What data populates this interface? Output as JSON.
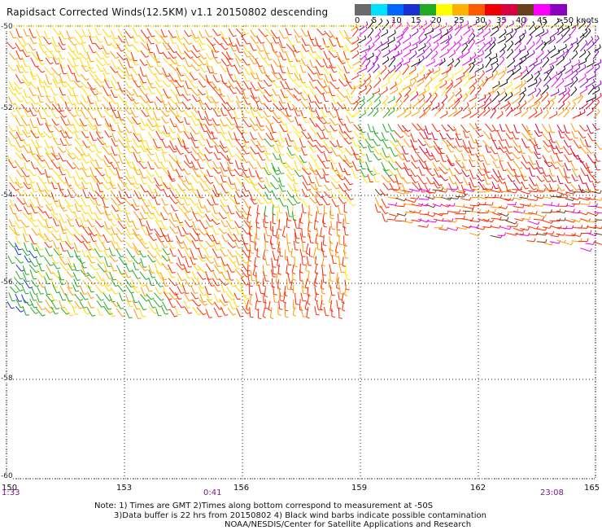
{
  "title": "Rapidsact Corrected Winds(12.5KM) v1.1 20150802 descending",
  "colorbar": {
    "labels": [
      "0",
      "5",
      "10",
      "15",
      "20",
      "25",
      "30",
      "35",
      "40",
      "45",
      ">50 knots"
    ],
    "colors": [
      "#6a6a6a",
      "#00e0ff",
      "#0066ff",
      "#1a2fd0",
      "#22aa22",
      "#ffff00",
      "#ffb000",
      "#ff5a00",
      "#ee0000",
      "#d80040",
      "#6a3f1c",
      "#ff00ff",
      "#8a00c0"
    ]
  },
  "map": {
    "lat_labels": [
      "-50",
      "-52",
      "-54",
      "-56",
      "-58",
      "-60"
    ],
    "lon_labels": [
      "150",
      "153",
      "156",
      "159",
      "162",
      "165"
    ],
    "time_labels": [
      "1:33",
      "0:41",
      "23:08"
    ],
    "lat_range": [
      -60,
      -50
    ],
    "lon_range": [
      150,
      165
    ]
  },
  "notes": {
    "line1": "Note: 1) Times are GMT 2)Times along bottom correspond to measurement at -50S",
    "line2": "3)Data buffer is 22 hrs from 20150802 4) Black wind barbs indicate possible contamination",
    "line3": "NOAA/NESDIS/Center for Satellite Applications and Research"
  }
}
